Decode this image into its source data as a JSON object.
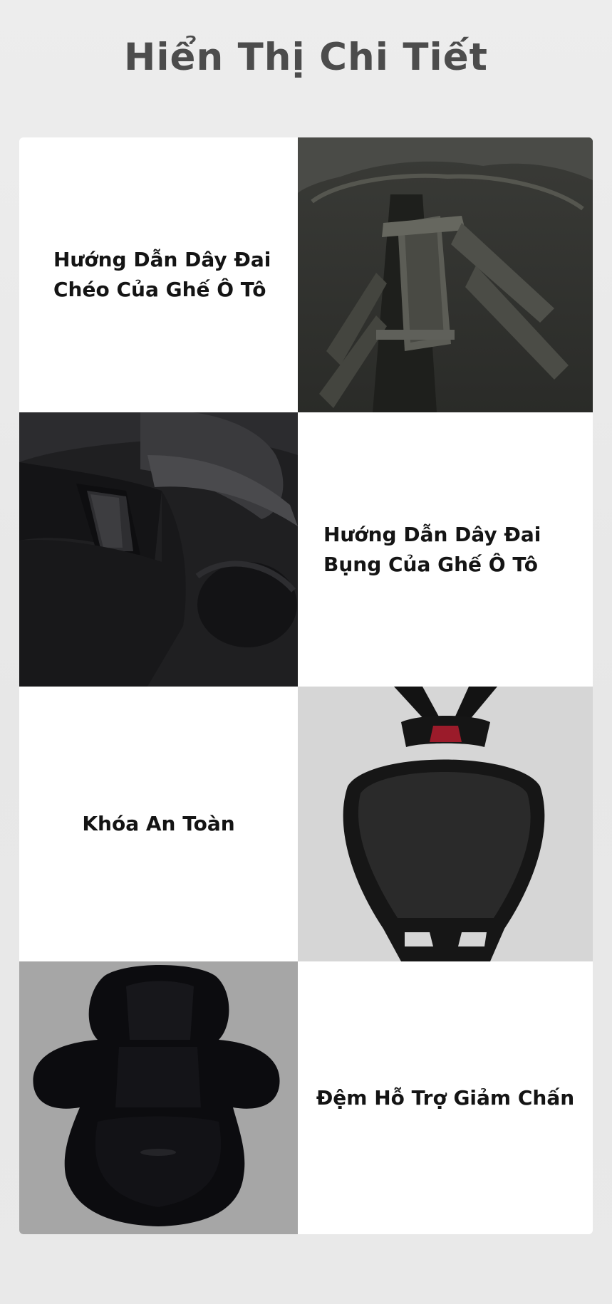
{
  "page": {
    "title": "Hiển Thị Chi Tiết"
  },
  "features": [
    {
      "label": "Hướng Dẫn Dây Đai\nChéo Của Ghế Ô Tô",
      "image": "diagonal-belt-guide-photo"
    },
    {
      "label": "Hướng Dẫn Dây Đai\nBụng Của Ghế Ô Tô",
      "image": "lap-belt-guide-photo"
    },
    {
      "label": "Khóa An Toàn",
      "image": "safety-buckle-photo"
    },
    {
      "label": "Đệm Hỗ Trợ Giảm Chấn",
      "image": "shock-absorbing-cushion-photo"
    }
  ],
  "colors": {
    "background": "#ebebeb",
    "title": "#4c4c4c",
    "label": "#141414",
    "card": "#ffffff",
    "buckle_accent": "#9b1b2a"
  }
}
